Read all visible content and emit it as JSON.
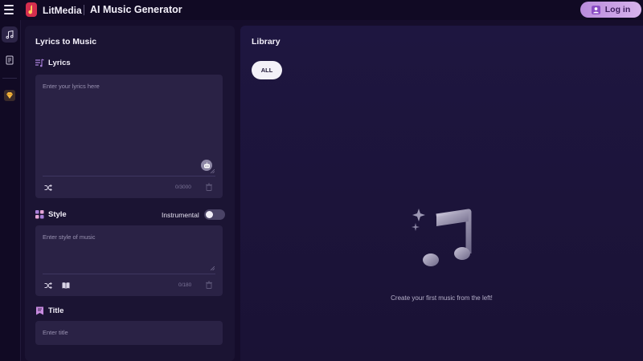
{
  "topbar": {
    "brand": "LitMedia",
    "app_title": "AI Music Generator",
    "login_label": "Log in"
  },
  "rail": {
    "items": [
      {
        "icon": "music-note-icon",
        "active": true
      },
      {
        "icon": "document-icon",
        "active": false
      },
      {
        "icon": "diamond-icon",
        "active": false
      }
    ]
  },
  "left_panel": {
    "title": "Lyrics to Music",
    "lyrics": {
      "label": "Lyrics",
      "placeholder": "Enter your lyrics here",
      "value": "",
      "counter": "0/3000"
    },
    "style": {
      "label": "Style",
      "placeholder": "Enter style of music",
      "value": "",
      "counter": "0/180",
      "instrumental_label": "Instrumental",
      "instrumental_on": false
    },
    "title_field": {
      "label": "Title",
      "placeholder": "Enter title",
      "value": ""
    }
  },
  "library": {
    "title": "Library",
    "filter_all": "ALL",
    "empty_text": "Create your first music from the left!"
  },
  "colors": {
    "background": "#150d2b",
    "panel": "#1b1433",
    "accent": "#c9a0e6",
    "chip": "#f3f1f8"
  }
}
